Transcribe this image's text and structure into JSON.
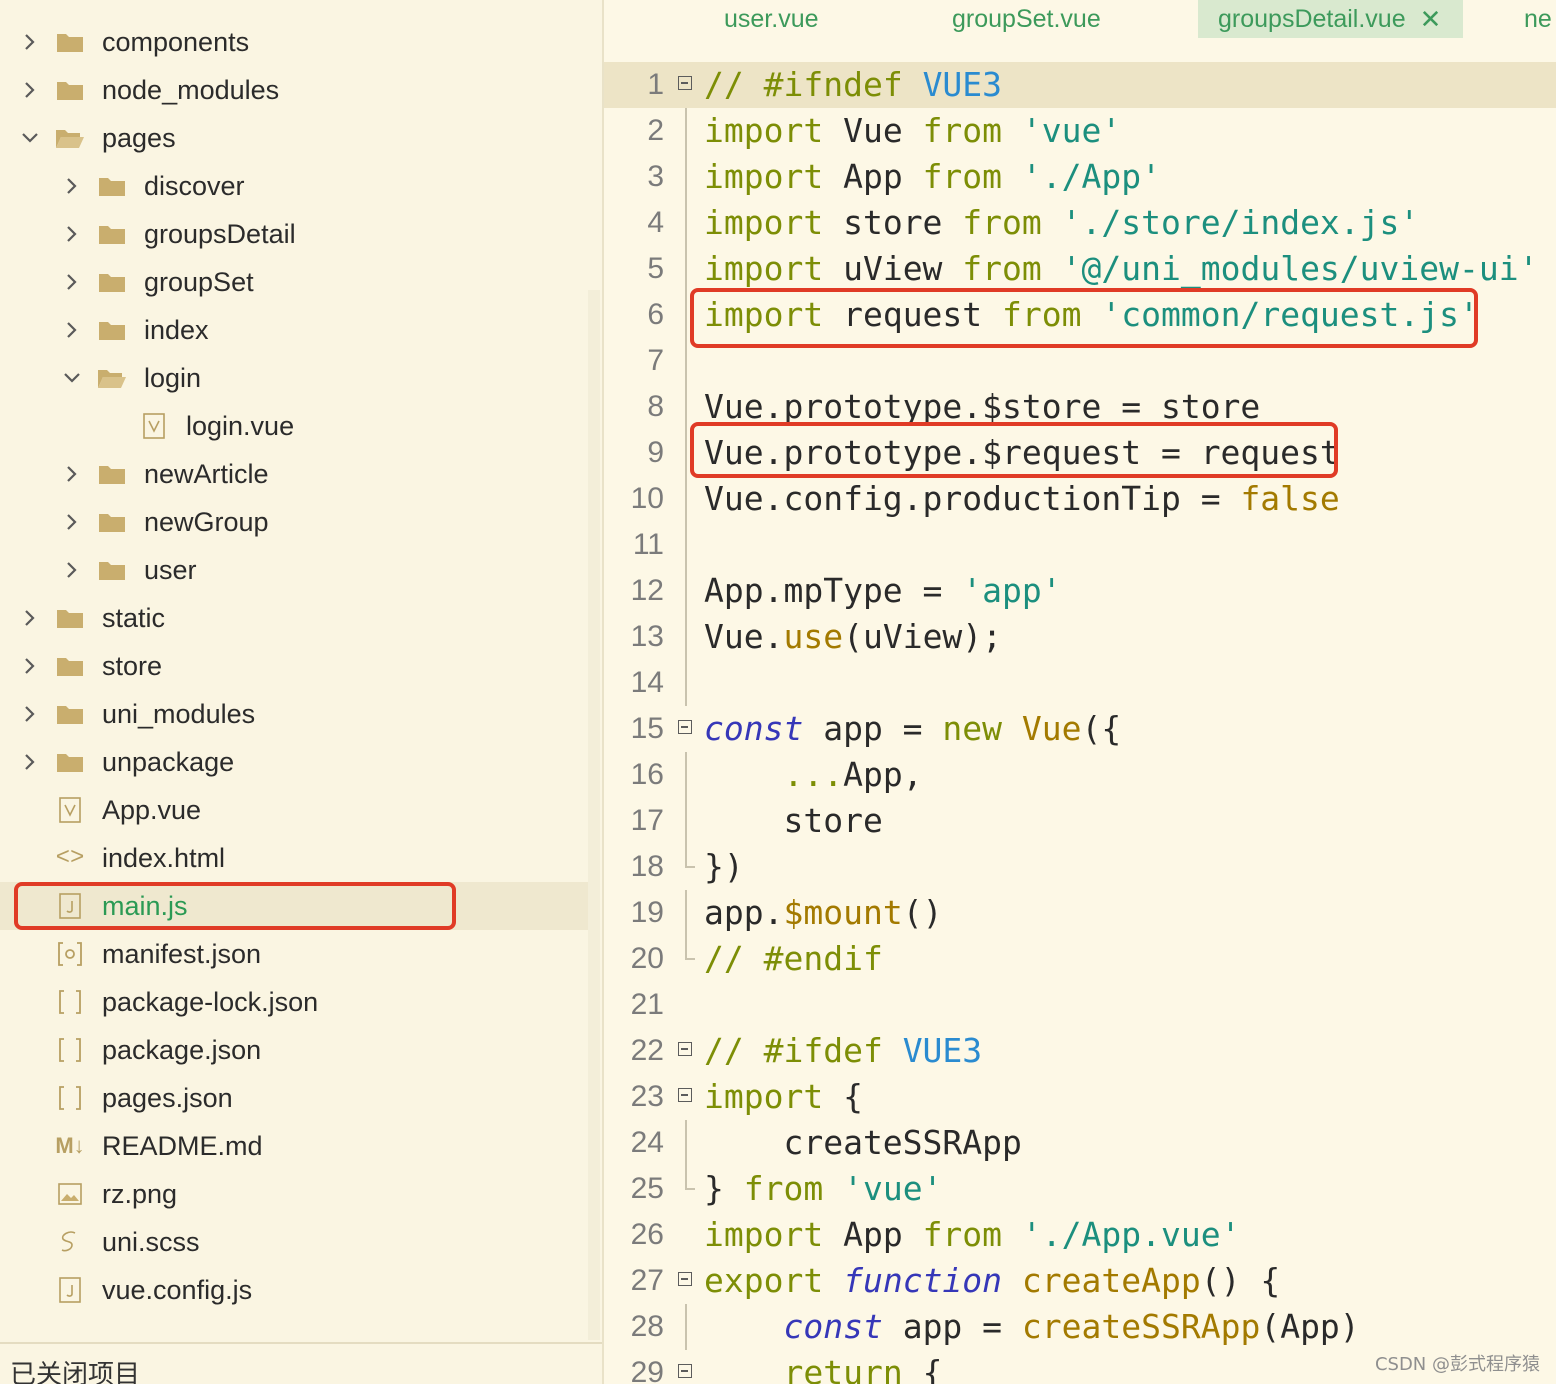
{
  "sidebar": {
    "items": [
      {
        "label": "components",
        "type": "folder",
        "expanded": false,
        "level": 0
      },
      {
        "label": "node_modules",
        "type": "folder",
        "expanded": false,
        "level": 0
      },
      {
        "label": "pages",
        "type": "folder",
        "expanded": true,
        "level": 0
      },
      {
        "label": "discover",
        "type": "folder",
        "expanded": false,
        "level": 1
      },
      {
        "label": "groupsDetail",
        "type": "folder",
        "expanded": false,
        "level": 1
      },
      {
        "label": "groupSet",
        "type": "folder",
        "expanded": false,
        "level": 1
      },
      {
        "label": "index",
        "type": "folder",
        "expanded": false,
        "level": 1
      },
      {
        "label": "login",
        "type": "folder",
        "expanded": true,
        "level": 1
      },
      {
        "label": "login.vue",
        "type": "vue-file",
        "level": 2
      },
      {
        "label": "newArticle",
        "type": "folder",
        "expanded": false,
        "level": 1
      },
      {
        "label": "newGroup",
        "type": "folder",
        "expanded": false,
        "level": 1
      },
      {
        "label": "user",
        "type": "folder",
        "expanded": false,
        "level": 1
      },
      {
        "label": "static",
        "type": "folder",
        "expanded": false,
        "level": 0
      },
      {
        "label": "store",
        "type": "folder",
        "expanded": false,
        "level": 0
      },
      {
        "label": "uni_modules",
        "type": "folder",
        "expanded": false,
        "level": 0
      },
      {
        "label": "unpackage",
        "type": "folder",
        "expanded": false,
        "level": 0
      },
      {
        "label": "App.vue",
        "type": "vue-file",
        "level": 0
      },
      {
        "label": "index.html",
        "type": "html-file",
        "level": 0
      },
      {
        "label": "main.js",
        "type": "js-file",
        "level": 0,
        "selected": true
      },
      {
        "label": "manifest.json",
        "type": "manifest-file",
        "level": 0
      },
      {
        "label": "package-lock.json",
        "type": "json-file",
        "level": 0
      },
      {
        "label": "package.json",
        "type": "json-file",
        "level": 0
      },
      {
        "label": "pages.json",
        "type": "json-file",
        "level": 0
      },
      {
        "label": "README.md",
        "type": "md-file",
        "level": 0
      },
      {
        "label": "rz.png",
        "type": "image-file",
        "level": 0
      },
      {
        "label": "uni.scss",
        "type": "scss-file",
        "level": 0
      },
      {
        "label": "vue.config.js",
        "type": "js-file",
        "level": 0
      }
    ],
    "closed_projects_label": "已关闭项目"
  },
  "tabs": [
    {
      "label": "user.vue",
      "active": false
    },
    {
      "label": "groupSet.vue",
      "active": false
    },
    {
      "label": "groupsDetail.vue",
      "active": true
    },
    {
      "label": "ne",
      "active": false
    }
  ],
  "editor": {
    "line_numbers": [
      "1",
      "2",
      "3",
      "4",
      "5",
      "6",
      "7",
      "8",
      "9",
      "10",
      "11",
      "12",
      "13",
      "14",
      "15",
      "16",
      "17",
      "18",
      "19",
      "20",
      "21",
      "22",
      "23",
      "24",
      "25",
      "26",
      "27",
      "28",
      "29"
    ],
    "lines": [
      [
        {
          "t": "//",
          "c": "cmt"
        },
        {
          "t": " #ifndef ",
          "c": "cmt"
        },
        {
          "t": "VUE3",
          "c": "blue"
        }
      ],
      [
        {
          "t": "import",
          "c": "kw"
        },
        {
          "t": " Vue ",
          "c": ""
        },
        {
          "t": "from",
          "c": "kw"
        },
        {
          "t": " ",
          "c": ""
        },
        {
          "t": "'vue'",
          "c": "str"
        }
      ],
      [
        {
          "t": "import",
          "c": "kw"
        },
        {
          "t": " App ",
          "c": ""
        },
        {
          "t": "from",
          "c": "kw"
        },
        {
          "t": " ",
          "c": ""
        },
        {
          "t": "'./App'",
          "c": "str"
        }
      ],
      [
        {
          "t": "import",
          "c": "kw"
        },
        {
          "t": " store ",
          "c": ""
        },
        {
          "t": "from",
          "c": "kw"
        },
        {
          "t": " ",
          "c": ""
        },
        {
          "t": "'./store/index.js'",
          "c": "str"
        }
      ],
      [
        {
          "t": "import",
          "c": "kw"
        },
        {
          "t": " uView ",
          "c": ""
        },
        {
          "t": "from",
          "c": "kw"
        },
        {
          "t": " ",
          "c": ""
        },
        {
          "t": "'@/uni_modules/uview-ui'",
          "c": "str"
        }
      ],
      [
        {
          "t": "import",
          "c": "kw"
        },
        {
          "t": " request ",
          "c": ""
        },
        {
          "t": "from",
          "c": "kw"
        },
        {
          "t": " ",
          "c": ""
        },
        {
          "t": "'common/request.js'",
          "c": "str"
        }
      ],
      [],
      [
        {
          "t": "Vue.prototype.$store = store",
          "c": ""
        }
      ],
      [
        {
          "t": "Vue.prototype.$request = request",
          "c": ""
        }
      ],
      [
        {
          "t": "Vue.config.productionTip = ",
          "c": ""
        },
        {
          "t": "false",
          "c": "fn"
        }
      ],
      [],
      [
        {
          "t": "App.mpType = ",
          "c": ""
        },
        {
          "t": "'app'",
          "c": "str"
        }
      ],
      [
        {
          "t": "Vue.",
          "c": ""
        },
        {
          "t": "use",
          "c": "fn"
        },
        {
          "t": "(uView);",
          "c": ""
        }
      ],
      [],
      [
        {
          "t": "const",
          "c": "ital"
        },
        {
          "t": " app = ",
          "c": ""
        },
        {
          "t": "new",
          "c": "kw"
        },
        {
          "t": " ",
          "c": ""
        },
        {
          "t": "Vue",
          "c": "fn"
        },
        {
          "t": "({",
          "c": ""
        }
      ],
      [
        {
          "t": "    ",
          "c": ""
        },
        {
          "t": "...",
          "c": "dots"
        },
        {
          "t": "App,",
          "c": ""
        }
      ],
      [
        {
          "t": "    store",
          "c": ""
        }
      ],
      [
        {
          "t": "})",
          "c": ""
        }
      ],
      [
        {
          "t": "app.",
          "c": ""
        },
        {
          "t": "$mount",
          "c": "fn"
        },
        {
          "t": "()",
          "c": ""
        }
      ],
      [
        {
          "t": "// #endif",
          "c": "cmt"
        }
      ],
      [],
      [
        {
          "t": "// #ifdef ",
          "c": "cmt"
        },
        {
          "t": "VUE3",
          "c": "blue"
        }
      ],
      [
        {
          "t": "import",
          "c": "kw"
        },
        {
          "t": " {",
          "c": ""
        }
      ],
      [
        {
          "t": "    createSSRApp",
          "c": ""
        }
      ],
      [
        {
          "t": "} ",
          "c": ""
        },
        {
          "t": "from",
          "c": "kw"
        },
        {
          "t": " ",
          "c": ""
        },
        {
          "t": "'vue'",
          "c": "str"
        }
      ],
      [
        {
          "t": "import",
          "c": "kw"
        },
        {
          "t": " App ",
          "c": ""
        },
        {
          "t": "from",
          "c": "kw"
        },
        {
          "t": " ",
          "c": ""
        },
        {
          "t": "'./App.vue'",
          "c": "str"
        }
      ],
      [
        {
          "t": "export",
          "c": "kw"
        },
        {
          "t": " ",
          "c": ""
        },
        {
          "t": "function",
          "c": "ital"
        },
        {
          "t": " ",
          "c": ""
        },
        {
          "t": "createApp",
          "c": "fn"
        },
        {
          "t": "() {",
          "c": ""
        }
      ],
      [
        {
          "t": "    ",
          "c": ""
        },
        {
          "t": "const",
          "c": "ital"
        },
        {
          "t": " app = ",
          "c": ""
        },
        {
          "t": "createSSRApp",
          "c": "fn"
        },
        {
          "t": "(App)",
          "c": ""
        }
      ],
      [
        {
          "t": "    ",
          "c": ""
        },
        {
          "t": "return",
          "c": "kw"
        },
        {
          "t": " {",
          "c": ""
        }
      ]
    ]
  },
  "watermark": "CSDN @彭式程序猿",
  "colors": {
    "background": "#fdf8e6",
    "keyword": "#7d8e06",
    "string": "#1c8f7e",
    "highlight_box": "#e03b26",
    "tab_text": "#3d9a5b"
  }
}
